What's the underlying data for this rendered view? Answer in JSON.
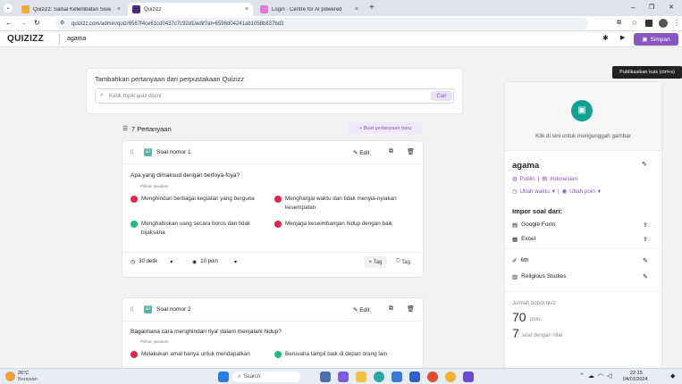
{
  "browser": {
    "tabs": [
      {
        "label": "Quizizz: Salsal Keterlibatan Sisw",
        "color": "#f0a93a"
      },
      {
        "label": "Quizizz",
        "color": "#4b2a83"
      },
      {
        "label": "Login · Centre for AI powered",
        "color": "#e57ad2"
      }
    ],
    "new_tab": "+",
    "url": "quizizz.com/admin/quiz/6567f4ce61cd0437c7c92d1/edit?at=6598d04241ab1058b637bd3",
    "controls": {
      "minimize": "–",
      "restore": "❐",
      "close": "✕"
    }
  },
  "app": {
    "logo": "QUIZIZZ",
    "quiz_name": "agama",
    "save_label": "Simpan",
    "tooltip": "Publikasikan kuis (ctrl+s)"
  },
  "library": {
    "heading": "Tambahkan pertanyaan dari perpustakaan Quizizz",
    "search_placeholder": "Ketik topik quiz disini",
    "search_button": "Cari"
  },
  "questions_header": {
    "count_label": "7 Pertanyaan",
    "new_question": "+ Buat pertanyaan baru"
  },
  "question1": {
    "label": "Soal nomor 1",
    "edit": "Edit",
    "text": "Apa yang dimaksud dengan berfoya-foya?",
    "choices_label": "Pilihan jawaban",
    "answers": [
      {
        "text": "Menghindari berbagai kegiatan yang berguna",
        "color": "#e0254e"
      },
      {
        "text": "Menghargai waktu dan tidak menyia-nyiakan kesempatan",
        "color": "#e0254e"
      },
      {
        "text": "Menghabiskan uang secara boros dan tidak bijaksana",
        "color": "#1fb97c"
      },
      {
        "text": "Menjaga keseimbangan hidup dengan baik",
        "color": "#e0254e"
      }
    ],
    "time": "30 detik",
    "points": "10 poin",
    "tag_remove": "Tag",
    "tag": "Tag"
  },
  "question2": {
    "label": "Soal nomor 2",
    "edit": "Edit",
    "text": "Bagaimana cara menghindari riya' dalam menjalani hidup?",
    "choices_label": "Pilihan jawaban",
    "answers": [
      {
        "text": "Melakukan amal hanya untuk mendapatkan",
        "color": "#e0254e"
      },
      {
        "text": "Berusaha tampil baik di depan orang lain",
        "color": "#1fb97c"
      }
    ]
  },
  "side": {
    "upload": "Klik di sini untuk mengunggah gambar",
    "title": "agama",
    "visibility": "Public",
    "language": "Indonesian",
    "change_time": "Ubah waktu",
    "change_points": "Ubah poin",
    "import_heading": "Impor soal dari:",
    "google_form": "Google Form",
    "excel": "Excel",
    "grade": "6th",
    "subject": "Religious Studies",
    "total_label": "Jumlah bobot quiz",
    "total_points": "70",
    "points_unit": "poin.",
    "question_count": "7",
    "question_unit": "soal dengan nilai"
  },
  "taskbar": {
    "weather_temp": "26°C",
    "weather_desc": "Berawan",
    "search": "Search",
    "time": "22:15",
    "date": "04/01/2024"
  }
}
